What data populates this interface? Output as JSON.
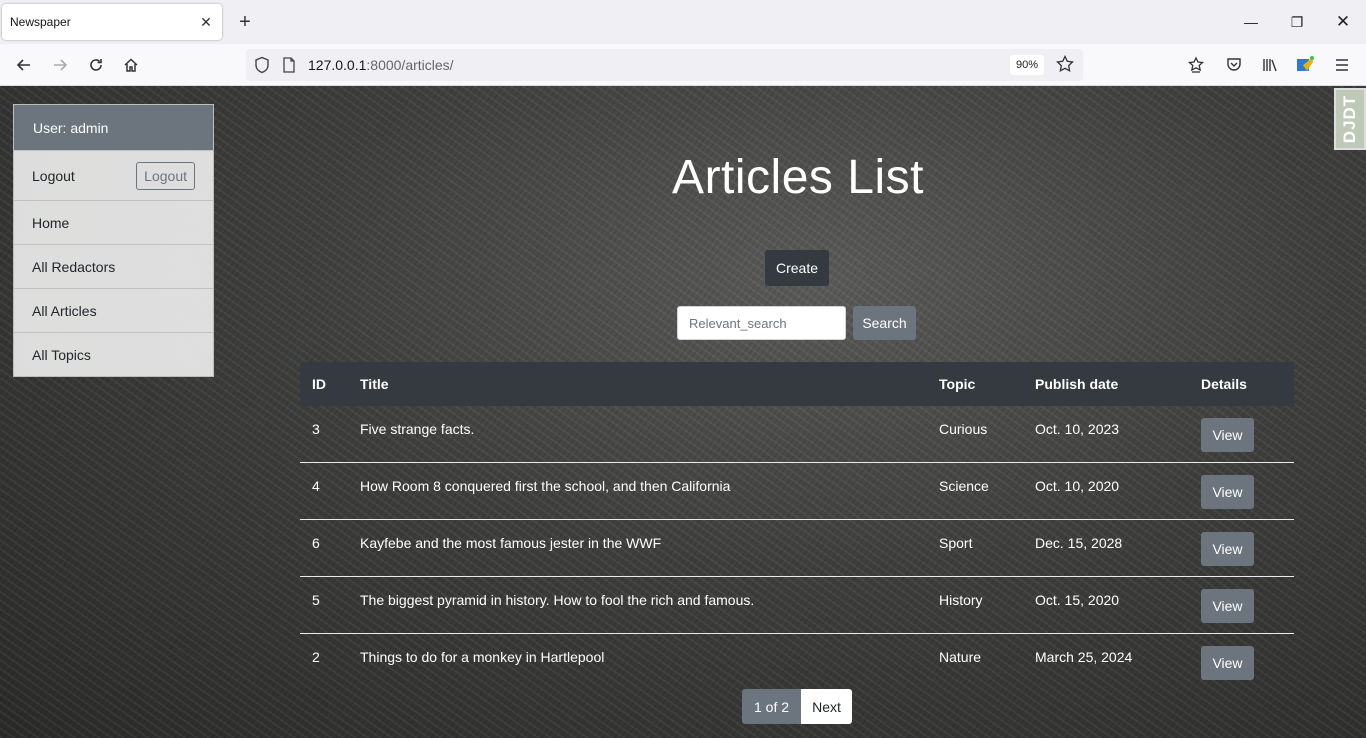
{
  "browser": {
    "tab_title": "Newspaper",
    "url_host": "127.0.0.1",
    "url_rest": ":8000/articles/",
    "zoom": "90%"
  },
  "debug_toolbar": {
    "label": "DJDT"
  },
  "sidebar": {
    "user_label": "User: admin",
    "logout_label": "Logout",
    "logout_button": "Logout",
    "items": [
      {
        "label": "Home"
      },
      {
        "label": "All Redactors"
      },
      {
        "label": "All Articles"
      },
      {
        "label": "All Topics"
      }
    ]
  },
  "main": {
    "title": "Articles List",
    "create_label": "Create",
    "search_placeholder": "Relevant_search",
    "search_label": "Search",
    "columns": [
      "ID",
      "Title",
      "Topic",
      "Publish date",
      "Details"
    ],
    "view_label": "View",
    "rows": [
      {
        "id": "3",
        "title": "Five strange facts.",
        "topic": "Curious",
        "date": "Oct. 10, 2023"
      },
      {
        "id": "4",
        "title": "How Room 8 conquered first the school, and then California",
        "topic": "Science",
        "date": "Oct. 10, 2020"
      },
      {
        "id": "6",
        "title": "Kayfebe and the most famous jester in the WWF",
        "topic": "Sport",
        "date": "Dec. 15, 2028"
      },
      {
        "id": "5",
        "title": "The biggest pyramid in history. How to fool the rich and famous.",
        "topic": "History",
        "date": "Oct. 15, 2020"
      },
      {
        "id": "2",
        "title": "Things to do for a monkey in Hartlepool",
        "topic": "Nature",
        "date": "March 25, 2024"
      }
    ],
    "pagination": {
      "current": "1 of 2",
      "next": "Next"
    }
  }
}
